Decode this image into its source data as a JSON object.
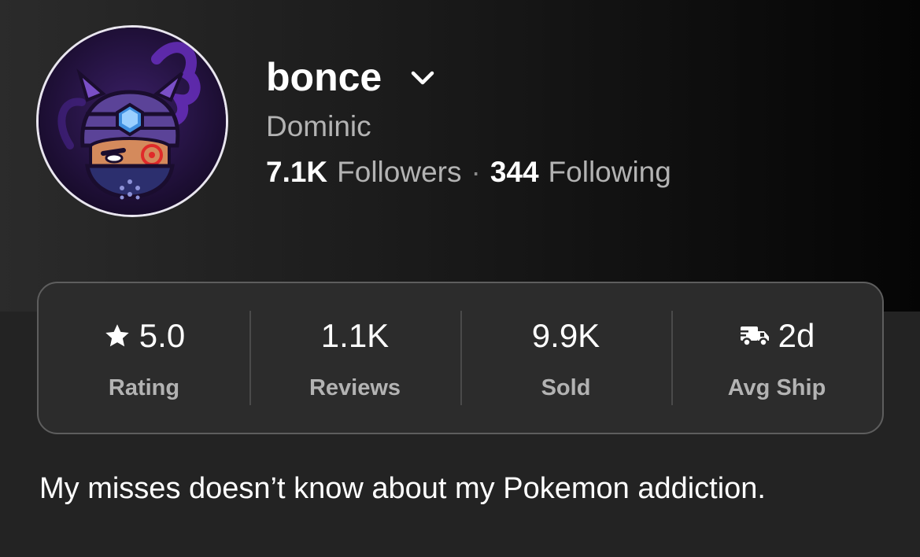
{
  "profile": {
    "username": "bonce",
    "display_name": "Dominic",
    "followers_count": "7.1K",
    "followers_label": "Followers",
    "separator": "·",
    "following_count": "344",
    "following_label": "Following",
    "avatar_icon": "ninja-avatar-icon",
    "dropdown_icon": "chevron-down-icon"
  },
  "stats": [
    {
      "value": "5.0",
      "label": "Rating",
      "icon": "star-icon"
    },
    {
      "value": "1.1K",
      "label": "Reviews"
    },
    {
      "value": "9.9K",
      "label": "Sold"
    },
    {
      "value": "2d",
      "label": "Avg Ship",
      "icon": "delivery-truck-icon"
    }
  ],
  "bio": "My misses doesn’t know about my Pokemon addiction.",
  "colors": {
    "background": "#232323",
    "card_background": "#2c2c2c",
    "card_border": "#5e5e5e",
    "primary_text": "#ffffff",
    "secondary_text": "#b3b3b3",
    "avatar_accent": "#7b3fd1"
  }
}
